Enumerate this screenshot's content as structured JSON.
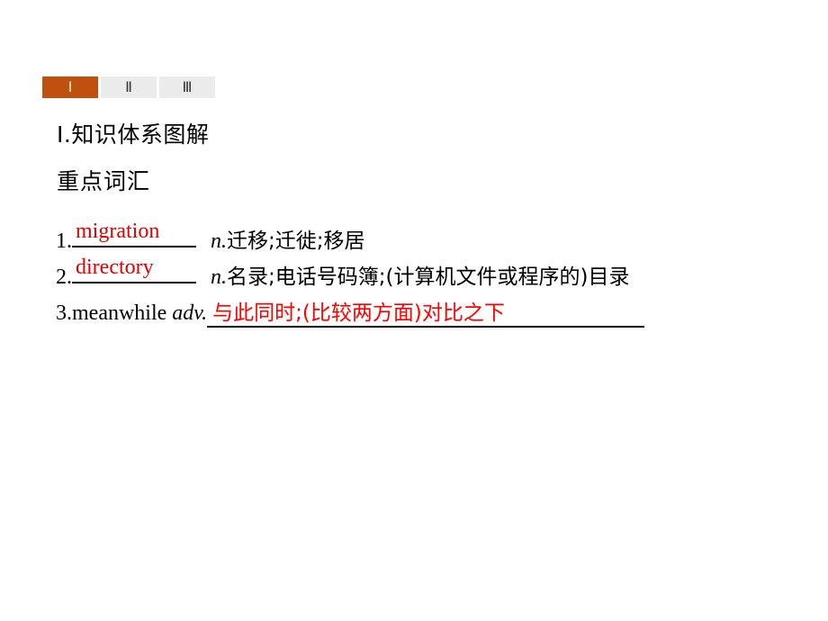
{
  "tabs": [
    {
      "label": "Ⅰ",
      "active": true
    },
    {
      "label": "Ⅱ",
      "active": false
    },
    {
      "label": "Ⅲ",
      "active": false
    }
  ],
  "section_title": {
    "numeral": "Ⅰ",
    "text": ".知识体系图解"
  },
  "subsection_title": "重点词汇",
  "items": [
    {
      "number": "1.",
      "answer": "migration",
      "pos": "n.",
      "definition": "迁移;迁徙;移居"
    },
    {
      "number": "2.",
      "answer": "directory",
      "pos": "n.",
      "definition": "名录;电话号码簿;(计算机文件或程序的)目录"
    },
    {
      "number": "3.",
      "word": "meanwhile",
      "pos": "adv.",
      "answer": "与此同时;(比较两方面)对比之下"
    }
  ],
  "colors": {
    "accent": "#c0500e",
    "answer": "#ff0000",
    "tab_inactive": "#ebebeb"
  }
}
